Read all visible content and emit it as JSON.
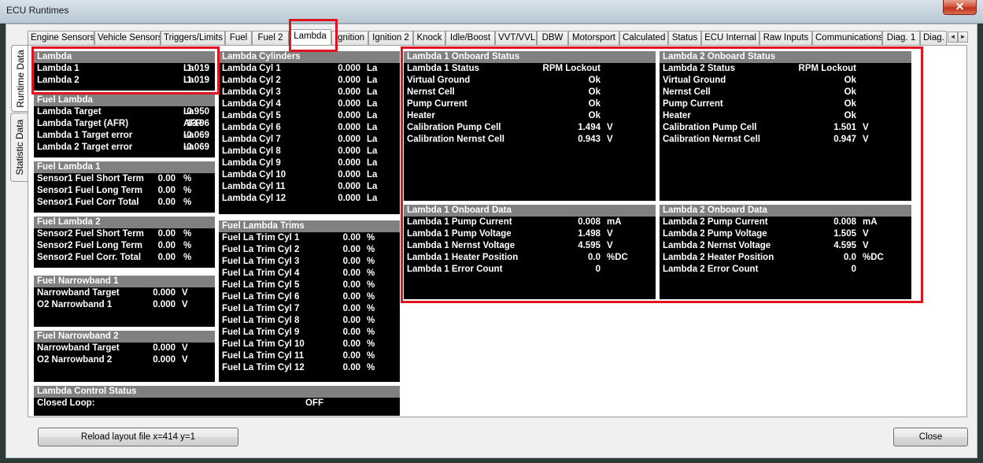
{
  "window": {
    "title": "ECU Runtimes",
    "close_glyph": "✕"
  },
  "side_tabs": [
    {
      "label": "Runtime Data"
    },
    {
      "label": "Statistic Data"
    }
  ],
  "tabs": [
    "Engine Sensors",
    "Vehicle Sensors",
    "Triggers/Limits",
    "Fuel",
    "Fuel 2",
    "Lambda",
    "Ignition",
    "Ignition 2",
    "Knock",
    "Idle/Boost",
    "VVT/VVL",
    "DBW",
    "Motorsport",
    "Calculated",
    "Status",
    "ECU Internal",
    "Raw Inputs",
    "Communications",
    "Diag. 1",
    "Diag."
  ],
  "active_tab": "Lambda",
  "tab_scroll": {
    "left": "◄",
    "right": "►"
  },
  "panels": {
    "lambda": {
      "title": "Lambda",
      "rows": [
        {
          "label": "Lambda 1",
          "value": "1.019",
          "unit": "La"
        },
        {
          "label": "Lambda 2",
          "value": "1.019",
          "unit": "La"
        }
      ]
    },
    "fuel_lambda": {
      "title": "Fuel Lambda",
      "rows": [
        {
          "label": "Lambda Target",
          "value": "0.950",
          "unit": "La"
        },
        {
          "label": "Lambda Target (AFR)",
          "value": "13.96",
          "unit": "AFR"
        },
        {
          "label": "Lambda 1 Target error",
          "value": "-0.069",
          "unit": "La"
        },
        {
          "label": "Lambda 2 Target error",
          "value": "-0.069",
          "unit": "La"
        }
      ]
    },
    "fuel_lambda_1": {
      "title": "Fuel Lambda 1",
      "rows": [
        {
          "label": "Sensor1 Fuel Short Term",
          "value": "0.00",
          "unit": "%"
        },
        {
          "label": "Sensor1 Fuel Long Term",
          "value": "0.00",
          "unit": "%"
        },
        {
          "label": "Sensor1 Fuel Corr Total",
          "value": "0.00",
          "unit": "%"
        }
      ]
    },
    "fuel_lambda_2": {
      "title": "Fuel Lambda 2",
      "rows": [
        {
          "label": "Sensor2 Fuel Short Term",
          "value": "0.00",
          "unit": "%"
        },
        {
          "label": "Sensor2 Fuel Long Term",
          "value": "0.00",
          "unit": "%"
        },
        {
          "label": "Sensor2 Fuel Corr. Total",
          "value": "0.00",
          "unit": "%"
        }
      ]
    },
    "fuel_narrowband_1": {
      "title": "Fuel Narrowband 1",
      "rows": [
        {
          "label": "Narrowband Target",
          "value": "0.000",
          "unit": "V"
        },
        {
          "label": "O2 Narrowband 1",
          "value": "0.000",
          "unit": "V"
        }
      ]
    },
    "fuel_narrowband_2": {
      "title": "Fuel Narrowband 2",
      "rows": [
        {
          "label": "Narrowband Target",
          "value": "0.000",
          "unit": "V"
        },
        {
          "label": "O2 Narrowband 2",
          "value": "0.000",
          "unit": "V"
        }
      ]
    },
    "lambda_control_status": {
      "title": "Lambda Control Status",
      "rows": [
        {
          "label": "Closed Loop:",
          "value": "OFF",
          "unit": ""
        }
      ]
    },
    "lambda_cylinders": {
      "title": "Lambda Cylinders",
      "rows": [
        {
          "label": "Lambda Cyl 1",
          "value": "0.000",
          "unit": "La"
        },
        {
          "label": "Lambda Cyl 2",
          "value": "0.000",
          "unit": "La"
        },
        {
          "label": "Lambda Cyl 3",
          "value": "0.000",
          "unit": "La"
        },
        {
          "label": "Lambda Cyl 4",
          "value": "0.000",
          "unit": "La"
        },
        {
          "label": "Lambda Cyl 5",
          "value": "0.000",
          "unit": "La"
        },
        {
          "label": "Lambda Cyl 6",
          "value": "0.000",
          "unit": "La"
        },
        {
          "label": "Lambda Cyl 7",
          "value": "0.000",
          "unit": "La"
        },
        {
          "label": "Lambda Cyl 8",
          "value": "0.000",
          "unit": "La"
        },
        {
          "label": "Lambda Cyl 9",
          "value": "0.000",
          "unit": "La"
        },
        {
          "label": "Lambda Cyl 10",
          "value": "0.000",
          "unit": "La"
        },
        {
          "label": "Lambda Cyl 11",
          "value": "0.000",
          "unit": "La"
        },
        {
          "label": "Lambda Cyl 12",
          "value": "0.000",
          "unit": "La"
        }
      ]
    },
    "fuel_lambda_trims": {
      "title": "Fuel Lambda Trims",
      "rows": [
        {
          "label": "Fuel La Trim Cyl 1",
          "value": "0.00",
          "unit": "%"
        },
        {
          "label": "Fuel La Trim Cyl 2",
          "value": "0.00",
          "unit": "%"
        },
        {
          "label": "Fuel La Trim Cyl 3",
          "value": "0.00",
          "unit": "%"
        },
        {
          "label": "Fuel La Trim Cyl 4",
          "value": "0.00",
          "unit": "%"
        },
        {
          "label": "Fuel La Trim Cyl 5",
          "value": "0.00",
          "unit": "%"
        },
        {
          "label": "Fuel La Trim Cyl 6",
          "value": "0.00",
          "unit": "%"
        },
        {
          "label": "Fuel La Trim Cyl 7",
          "value": "0.00",
          "unit": "%"
        },
        {
          "label": "Fuel La Trim Cyl 8",
          "value": "0.00",
          "unit": "%"
        },
        {
          "label": "Fuel La Trim Cyl 9",
          "value": "0.00",
          "unit": "%"
        },
        {
          "label": "Fuel La Trim Cyl 10",
          "value": "0.00",
          "unit": "%"
        },
        {
          "label": "Fuel La Trim Cyl 11",
          "value": "0.00",
          "unit": "%"
        },
        {
          "label": "Fuel La Trim Cyl 12",
          "value": "0.00",
          "unit": "%"
        }
      ]
    },
    "lambda_1_onboard_status": {
      "title": "Lambda 1 Onboard Status",
      "rows": [
        {
          "label": "Lambda 1 Status",
          "value": "RPM Lockout",
          "unit": ""
        },
        {
          "label": "Virtual Ground",
          "value": "Ok",
          "unit": ""
        },
        {
          "label": "Nernst Cell",
          "value": "Ok",
          "unit": ""
        },
        {
          "label": "Pump Current",
          "value": "Ok",
          "unit": ""
        },
        {
          "label": "Heater",
          "value": "Ok",
          "unit": ""
        },
        {
          "label": "Calibration Pump Cell",
          "value": "1.494",
          "unit": "V"
        },
        {
          "label": "Calibration Nernst Cell",
          "value": "0.943",
          "unit": "V"
        }
      ]
    },
    "lambda_2_onboard_status": {
      "title": "Lambda 2 Onboard Status",
      "rows": [
        {
          "label": "Lambda 2 Status",
          "value": "RPM Lockout",
          "unit": ""
        },
        {
          "label": "Virtual Ground",
          "value": "Ok",
          "unit": ""
        },
        {
          "label": "Nernst Cell",
          "value": "Ok",
          "unit": ""
        },
        {
          "label": "Pump Current",
          "value": "Ok",
          "unit": ""
        },
        {
          "label": "Heater",
          "value": "Ok",
          "unit": ""
        },
        {
          "label": "Calibration Pump Cell",
          "value": "1.501",
          "unit": "V"
        },
        {
          "label": "Calibration Nernst Cell",
          "value": "0.947",
          "unit": "V"
        }
      ]
    },
    "lambda_1_onboard_data": {
      "title": "Lambda 1 Onboard Data",
      "rows": [
        {
          "label": "Lambda 1 Pump Current",
          "value": "0.008",
          "unit": "mA"
        },
        {
          "label": "Lambda 1 Pump Voltage",
          "value": "1.498",
          "unit": "V"
        },
        {
          "label": "Lambda 1 Nernst Voltage",
          "value": "4.595",
          "unit": "V"
        },
        {
          "label": "Lambda 1 Heater Position",
          "value": "0.0",
          "unit": "%DC"
        },
        {
          "label": "Lambda 1 Error Count",
          "value": "0",
          "unit": ""
        }
      ]
    },
    "lambda_2_onboard_data": {
      "title": "Lambda 2 Onboard Data",
      "rows": [
        {
          "label": "Lambda 2 Pump Current",
          "value": "0.008",
          "unit": "mA"
        },
        {
          "label": "Lambda 2 Pump Voltage",
          "value": "1.505",
          "unit": "V"
        },
        {
          "label": "Lambda 2 Nernst Voltage",
          "value": "4.595",
          "unit": "V"
        },
        {
          "label": "Lambda 2 Heater Position",
          "value": "0.0",
          "unit": "%DC"
        },
        {
          "label": "Lambda 2 Error Count",
          "value": "0",
          "unit": ""
        }
      ]
    }
  },
  "footer": {
    "reload_button": "Reload layout file x=414 y=1",
    "close_button": "Close"
  },
  "colors": {
    "panel_bg": "#000000",
    "panel_header": "#808080",
    "highlight": "#e0141e"
  }
}
